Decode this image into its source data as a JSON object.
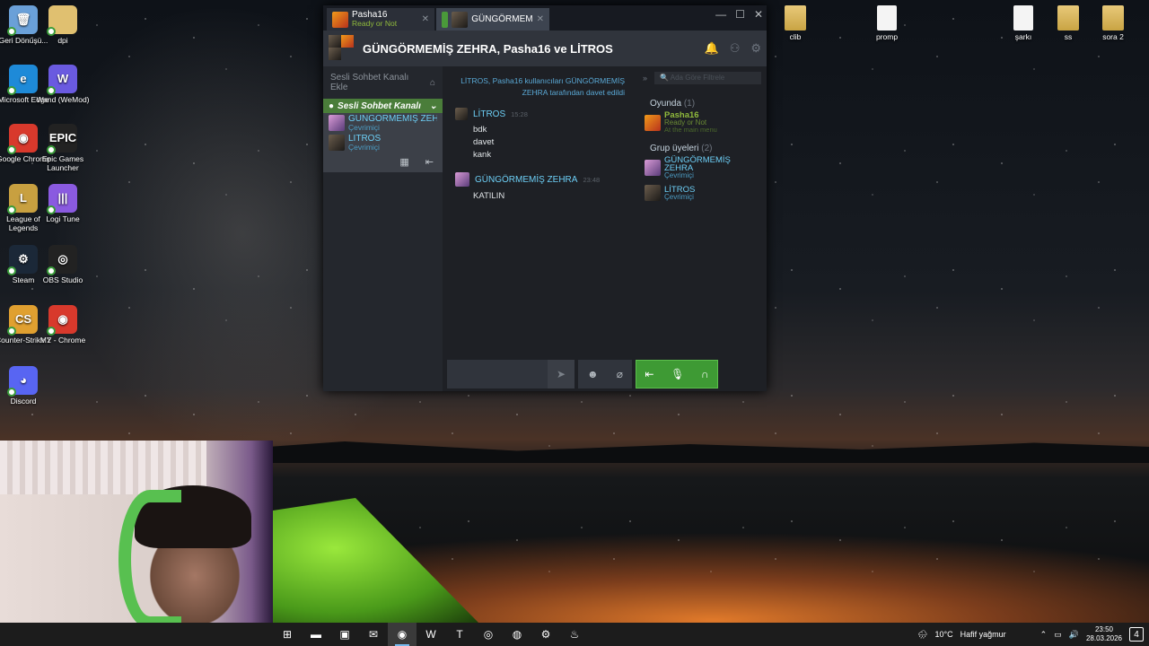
{
  "desktop": {
    "icons": [
      {
        "name": "recycle-bin-icon",
        "label": "Geri Dönüşü...",
        "color": "#6aa0d8",
        "glyph": "🗑"
      },
      {
        "name": "dpi-folder-icon",
        "label": "dpi",
        "color": "#e0c070",
        "glyph": ""
      },
      {
        "name": "edge-icon",
        "label": "Microsoft Edge",
        "color": "#1e8ad8",
        "glyph": "e"
      },
      {
        "name": "wand-icon",
        "label": "Wand (WeMod)",
        "color": "#6a5ae0",
        "glyph": "W"
      },
      {
        "name": "chrome-icon",
        "label": "Google Chrome",
        "color": "#d8392c",
        "glyph": "◉"
      },
      {
        "name": "epic-icon",
        "label": "Epic Games Launcher",
        "color": "#222222",
        "glyph": "EPIC"
      },
      {
        "name": "lol-icon",
        "label": "League of Legends",
        "color": "#c8a040",
        "glyph": "L"
      },
      {
        "name": "logitune-icon",
        "label": "Logi Tune",
        "color": "#8a5ae0",
        "glyph": "|||"
      },
      {
        "name": "steam-desktop-icon",
        "label": "Steam",
        "color": "#1b2838",
        "glyph": "⚙"
      },
      {
        "name": "obs-icon",
        "label": "OBS Studio",
        "color": "#222222",
        "glyph": "◎"
      },
      {
        "name": "cs2-icon",
        "label": "Counter-Strike 2",
        "color": "#e0a030",
        "glyph": "CS"
      },
      {
        "name": "my-chrome-icon",
        "label": "MY - Chrome",
        "color": "#d8392c",
        "glyph": "◉"
      },
      {
        "name": "discord-icon",
        "label": "Discord",
        "color": "#5865f2",
        "glyph": "◕"
      }
    ],
    "right_icons": [
      {
        "name": "clib-folder-icon",
        "label": "clib",
        "kind": "folder"
      },
      {
        "name": "promp-file-icon",
        "label": "promp",
        "kind": "file"
      },
      {
        "name": "sarki-file-icon",
        "label": "şarkı",
        "kind": "file"
      },
      {
        "name": "ss-folder-icon",
        "label": "ss",
        "kind": "folder"
      },
      {
        "name": "sora2-folder-icon",
        "label": "sora 2",
        "kind": "folder"
      }
    ]
  },
  "steam": {
    "tabs": [
      {
        "name": "Pasha16",
        "status": "Ready or Not"
      },
      {
        "name": "GÜNGÖRMEM"
      }
    ],
    "header_title": "GÜNGÖRMEMİŞ ZEHRA, Pasha16 ve LİTROS",
    "add_channel": "Sesli Sohbet Kanalı Ekle",
    "voice_channel": "Sesli Sohbet Kanalı",
    "voice_members": [
      {
        "name": "GÜNGÖRMEMİŞ ZEHRA",
        "status": "Çevrimiçi"
      },
      {
        "name": "LİTROS",
        "status": "Çevrimiçi"
      }
    ],
    "system_message": "LİTROS, Pasha16 kullanıcıları GÜNGÖRMEMİŞ ZEHRA tarafından davet edildi",
    "messages": [
      {
        "author": "LİTROS",
        "time": "15:28",
        "lines": [
          "bdk",
          "davet",
          "kank"
        ]
      },
      {
        "author": "GÜNGÖRMEMİŞ ZEHRA",
        "time": "23:48",
        "lines": [
          "KATILIN"
        ]
      }
    ],
    "filter_placeholder": "Ada Göre Filtrele",
    "in_game_label": "Oyunda",
    "in_game_count": "(1)",
    "in_game": [
      {
        "name": "Pasha16",
        "game": "Ready or Not",
        "detail": "At the main menu"
      }
    ],
    "group_label": "Grup üyeleri",
    "group_count": "(2)",
    "group_members": [
      {
        "name": "GÜNGÖRMEMİŞ ZEHRA",
        "status": "Çevrimiçi"
      },
      {
        "name": "LİTROS",
        "status": "Çevrimiçi"
      }
    ]
  },
  "taskbar": {
    "weather_temp": "10°C",
    "weather_text": "Hafif yağmur",
    "time": "23:50",
    "date": "28.03.2026",
    "notifications": "4",
    "apps": [
      "windows-icon",
      "file-explorer-icon",
      "store-icon",
      "mail-icon",
      "chrome-icon",
      "wps-icon",
      "teams-icon",
      "capture-icon",
      "firefox-icon",
      "settings-icon",
      "steam-icon"
    ]
  },
  "colors": {
    "steam_green": "#90ba3c",
    "steam_blue": "#6dcff6",
    "voice_green": "#3e9a34"
  }
}
